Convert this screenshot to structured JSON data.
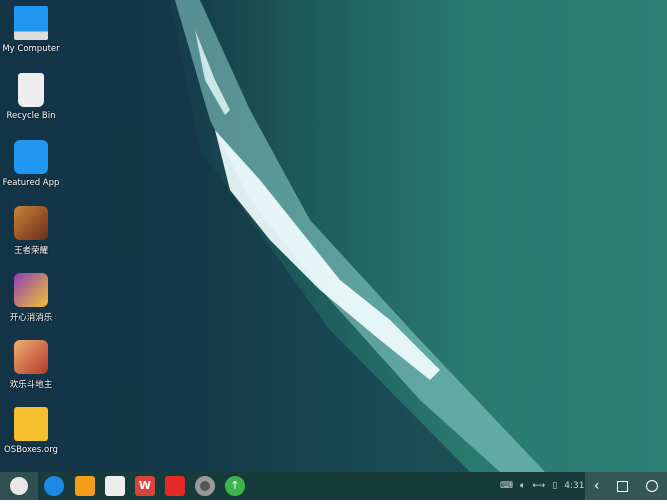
{
  "desktop": {
    "icons": [
      {
        "label": "My Computer",
        "icon": "laptop-icon"
      },
      {
        "label": "Recycle Bin",
        "icon": "trash-icon"
      },
      {
        "label": "Featured App",
        "icon": "shopping-bag-icon"
      },
      {
        "label": "王者荣耀",
        "icon": "game-icon"
      },
      {
        "label": "开心消消乐",
        "icon": "game-icon"
      },
      {
        "label": "欢乐斗地主",
        "icon": "game-icon"
      },
      {
        "label": "OSBoxes.org",
        "icon": "folder-icon"
      }
    ]
  },
  "taskbar": {
    "apps": [
      "browser-icon",
      "file-manager-icon",
      "notes-icon",
      "wps-office-icon",
      "mail-icon",
      "settings-icon",
      "update-icon"
    ],
    "clock": "4:31",
    "colors": {
      "bar": "#173a3b",
      "nav": "#345755"
    }
  }
}
